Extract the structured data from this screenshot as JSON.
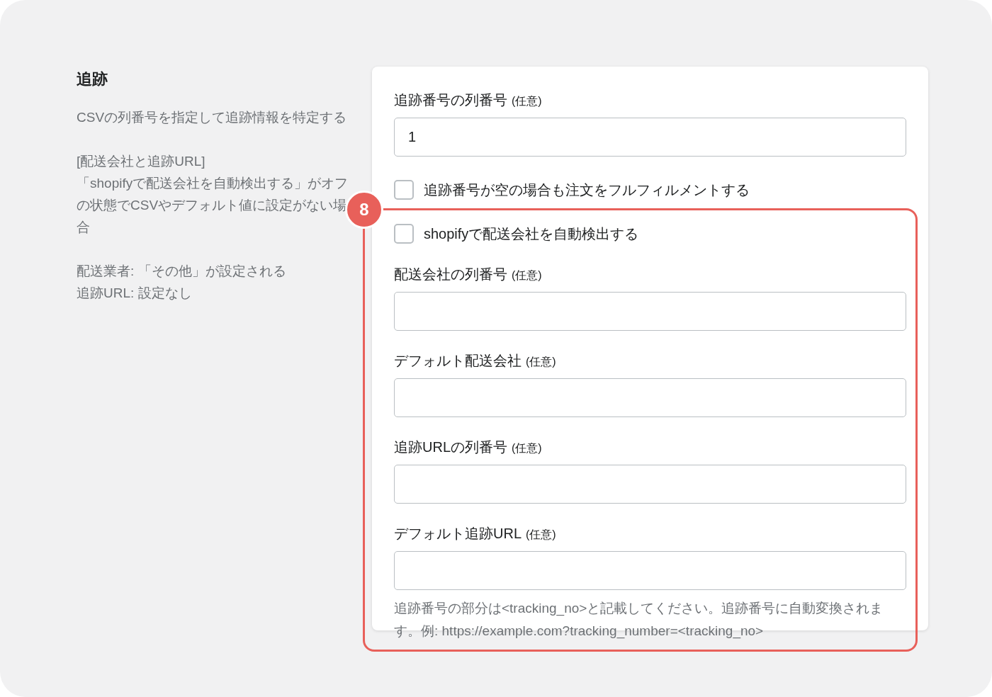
{
  "section": {
    "title": "追跡",
    "paragraphs": [
      [
        "CSVの列番号を指定して追跡情報を特定する"
      ],
      [
        "[配送会社と追跡URL]",
        "「shopifyで配送会社を自動検出する」がオフの状態でCSVやデフォルト値に設定がない場合"
      ],
      [
        "配送業者: 「その他」が設定される",
        "追跡URL: 設定なし"
      ]
    ]
  },
  "form": {
    "items": [
      {
        "kind": "field",
        "label": "追跡番号の列番号",
        "optional": "(任意)",
        "value": "1"
      },
      {
        "kind": "checkbox",
        "label": "追跡番号が空の場合も注文をフルフィルメントする",
        "checked": false
      }
    ],
    "callout": {
      "badge": "8",
      "items": [
        {
          "kind": "checkbox",
          "label": "shopifyで配送会社を自動検出する",
          "checked": false
        },
        {
          "kind": "field",
          "label": "配送会社の列番号",
          "optional": "(任意)",
          "value": ""
        },
        {
          "kind": "field",
          "label": "デフォルト配送会社",
          "optional": "(任意)",
          "value": ""
        },
        {
          "kind": "field",
          "label": "追跡URLの列番号",
          "optional": "(任意)",
          "value": ""
        },
        {
          "kind": "field",
          "label": "デフォルト追跡URL",
          "optional": "(任意)",
          "value": ""
        },
        {
          "kind": "help",
          "text": "追跡番号の部分は<tracking_no>と記載してください。追跡番号に自動変換されます。例: https://example.com?tracking_number=<tracking_no>"
        }
      ]
    }
  }
}
